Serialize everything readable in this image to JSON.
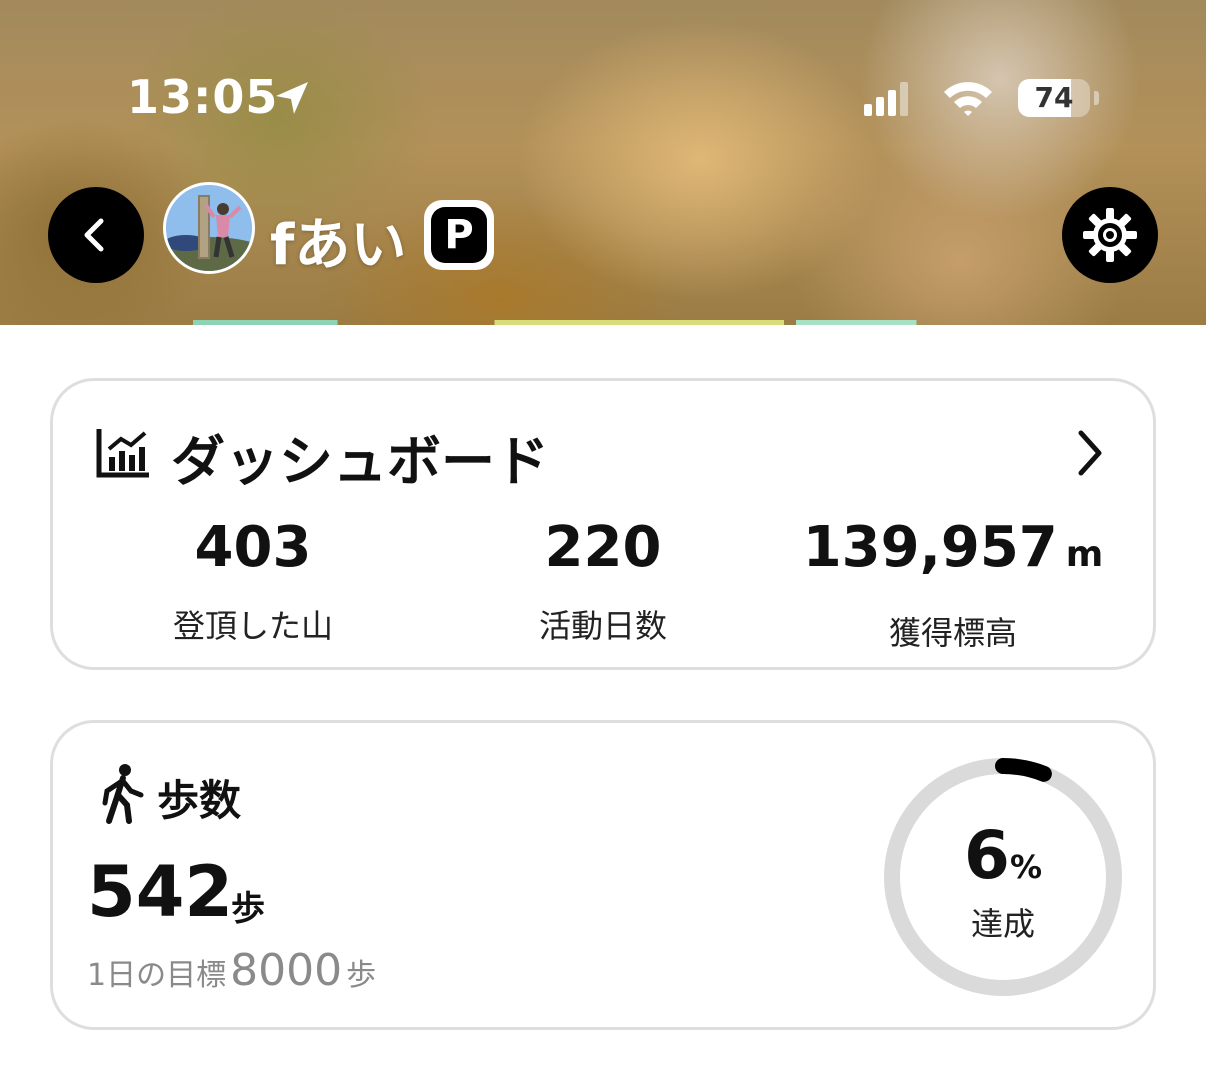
{
  "status_bar": {
    "time": "13:05",
    "battery": "74",
    "battery_level": 0.74
  },
  "header": {
    "username": "fあい",
    "premium_badge": "P"
  },
  "dashboard": {
    "title": "ダッシュボード",
    "stats": [
      {
        "value": "403",
        "unit": "",
        "label": "登頂した山"
      },
      {
        "value": "220",
        "unit": "",
        "label": "活動日数"
      },
      {
        "value": "139,957",
        "unit": "m",
        "label": "獲得標高"
      }
    ]
  },
  "steps": {
    "title": "歩数",
    "value": "542",
    "unit": "歩",
    "goal_label": "1日の目標",
    "goal_value": "8000",
    "goal_unit": "歩",
    "progress_value": "6",
    "progress_sign": "%",
    "progress_label": "達成",
    "progress_fraction": 0.06
  },
  "colors": {
    "ring_track": "#dadada",
    "ring_fill": "#000000",
    "card_border": "#dedede"
  }
}
